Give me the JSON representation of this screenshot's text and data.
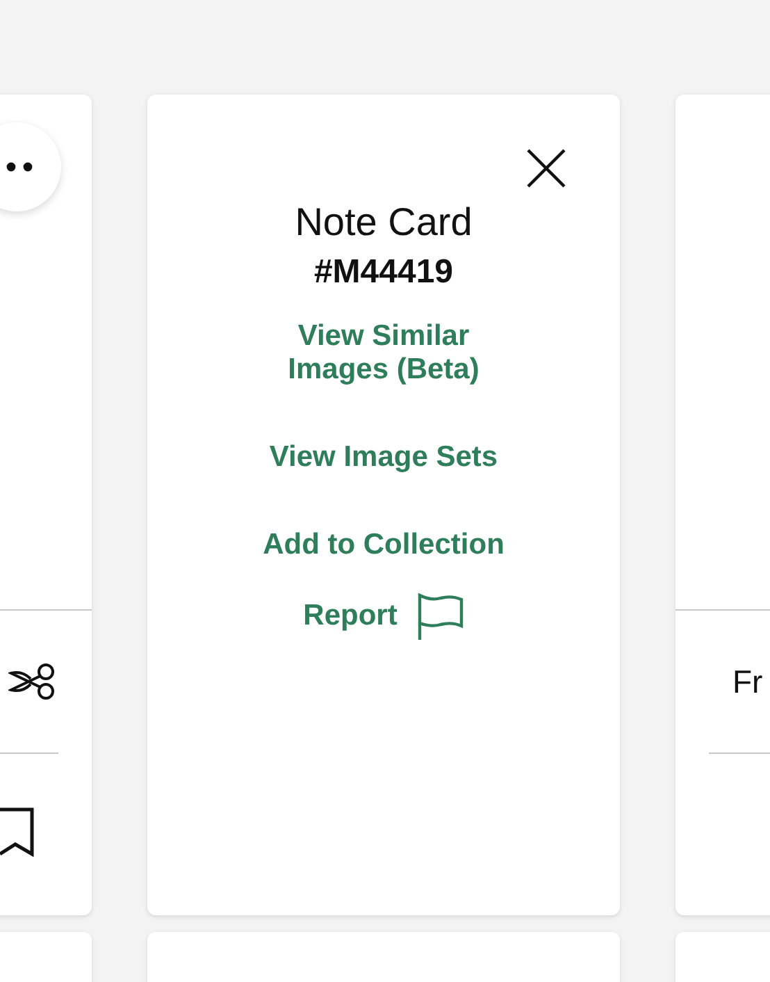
{
  "popup": {
    "title": "Note Card",
    "id": "#M44419",
    "links": [
      {
        "label": "View Similar Images (Beta)"
      },
      {
        "label": "View Image Sets"
      },
      {
        "label": "Add to Collection"
      }
    ],
    "report": "Report"
  },
  "right_card": {
    "text": "Fr"
  }
}
